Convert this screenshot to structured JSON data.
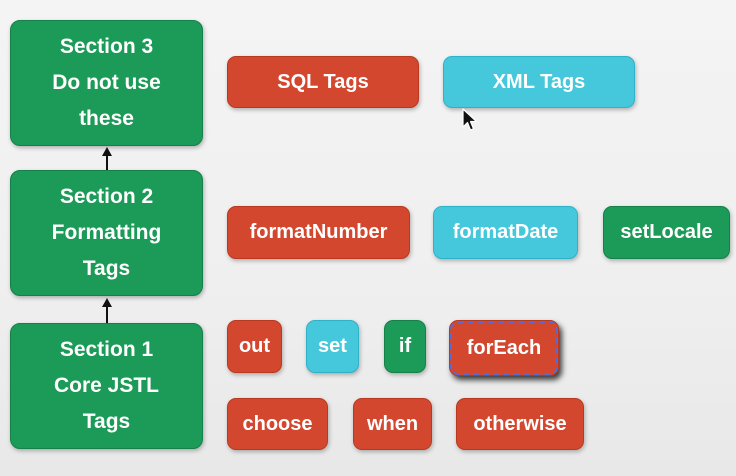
{
  "sections": [
    {
      "lines": [
        "Section 3",
        "Do not use",
        "these"
      ]
    },
    {
      "lines": [
        "Section 2",
        "Formatting",
        "Tags"
      ]
    },
    {
      "lines": [
        "Section 1",
        "Core JSTL",
        "Tags"
      ]
    }
  ],
  "section3_tags": [
    "SQL Tags",
    "XML Tags"
  ],
  "section2_tags": [
    "formatNumber",
    "formatDate",
    "setLocale"
  ],
  "section1_tags": {
    "row1": [
      "out",
      "set",
      "if",
      "forEach"
    ],
    "row2": [
      "choose",
      "when",
      "otherwise"
    ]
  },
  "colors": {
    "green": "#1c9a57",
    "red": "#d4472f",
    "cyan": "#45c8dc",
    "selection_outline": "#5a6ad0"
  },
  "icons": {
    "pointer": "mouse-pointer-icon",
    "arrow": "arrow-up-icon"
  }
}
